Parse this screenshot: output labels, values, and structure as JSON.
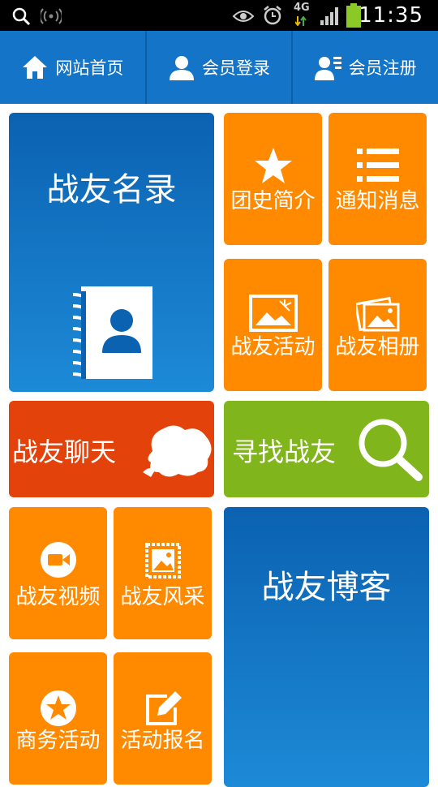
{
  "status_bar": {
    "time": "11:35",
    "network": "4G",
    "icons": [
      "search-icon",
      "wifi-icon",
      "eye-icon",
      "alarm-icon",
      "signal-icon",
      "battery-icon"
    ]
  },
  "nav": {
    "home": "网站首页",
    "login": "会员登录",
    "register": "会员注册"
  },
  "tiles": {
    "roster": "战友名录",
    "history": "团史简介",
    "notice": "通知消息",
    "activity": "战友活动",
    "album": "战友相册",
    "chat": "战友聊天",
    "find": "寻找战友",
    "video": "战友视频",
    "style": "战友风采",
    "blog": "战友博客",
    "business": "商务活动",
    "signup": "活动报名"
  },
  "colors": {
    "nav_bg": "#1474c7",
    "orange": "#ff8a00",
    "blue": "#0b62b1",
    "red": "#e3430b",
    "green": "#80b51b"
  }
}
